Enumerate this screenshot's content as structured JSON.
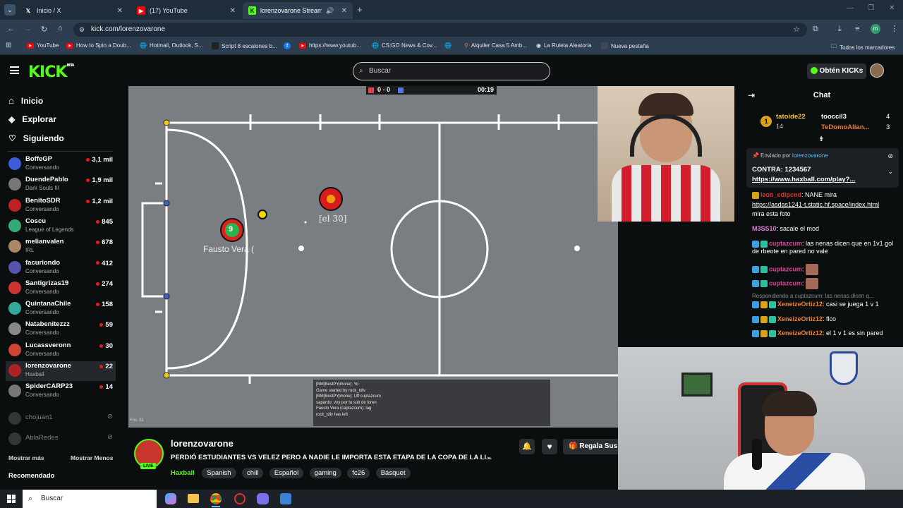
{
  "browser": {
    "tabs": [
      {
        "label": "Inicio / X"
      },
      {
        "label": "(17) YouTube"
      },
      {
        "label": "lorenzovarone Stream - Wa"
      }
    ],
    "url": "kick.com/lorenzovarone",
    "bookmarks": [
      "YouTube",
      "How to Spin a Doub...",
      "Hotmail, Outlook, S...",
      "Script 8 escalones b...",
      "https://www.youtub...",
      "CS:GO News & Cov...",
      "Alquiler Casa 5 Amb...",
      "La Ruleta Aleatoria",
      "Nueva pestaña",
      "Todos los marcadores"
    ]
  },
  "header": {
    "logo": "KICK",
    "logo_badge": "BETA",
    "search_placeholder": "Buscar",
    "get_kicks": "Obtén KICKs"
  },
  "sidebar": {
    "nav": [
      "Inicio",
      "Explorar",
      "Siguiendo"
    ],
    "channels": [
      {
        "name": "BoffeGP",
        "sub": "Conversando",
        "viewers": "3,1 mil"
      },
      {
        "name": "DuendePablo",
        "sub": "Dark Souls III",
        "viewers": "1,9 mil"
      },
      {
        "name": "BenitoSDR",
        "sub": "Conversando",
        "viewers": "1,2 mil"
      },
      {
        "name": "Coscu",
        "sub": "League of Legends",
        "viewers": "845"
      },
      {
        "name": "melianvalen",
        "sub": "IRL",
        "viewers": "678"
      },
      {
        "name": "facuriondo",
        "sub": "Conversando",
        "viewers": "412"
      },
      {
        "name": "Santigrizas19",
        "sub": "Conversando",
        "viewers": "274"
      },
      {
        "name": "QuintanaChile",
        "sub": "Conversando",
        "viewers": "158"
      },
      {
        "name": "Natabenitezzz",
        "sub": "Conversando",
        "viewers": "59"
      },
      {
        "name": "Lucassveronn",
        "sub": "Conversando",
        "viewers": "30"
      },
      {
        "name": "lorenzovarone",
        "sub": "Haxball",
        "viewers": "22"
      },
      {
        "name": "SpiderCARP23",
        "sub": "Conversando",
        "viewers": "14"
      }
    ],
    "offline": [
      "chojuan1",
      "AblaRedes"
    ],
    "show_more": "Mostrar más",
    "show_less": "Mostrar Menos",
    "recommended": "Recomendado"
  },
  "game": {
    "score": "0 - 0",
    "time": "00:19",
    "player1": "Fausto Vera (",
    "player1_number": "9",
    "player2": "[el 30]",
    "fps": "Fps: 61",
    "log": [
      "[BM]BestPYphone]: Yo",
      "Game started by rock_tdlv",
      "[BM]BestPYphone]: Uff cuptazcum",
      "sapardo: voy por la sub de loren",
      "Fausto Vera (captazcum): lag",
      "rock_tdlv has left"
    ]
  },
  "stream": {
    "channel": "lorenzovarone",
    "live": "LIVE",
    "title": "PERDIÓ ESTUDIANTES VS VELEZ PERO A NADIE LE IMPORTA ESTA ETAPA DE LA COPA DE LA LI...",
    "category": "Haxball",
    "tags": [
      "Spanish",
      "chill",
      "Español",
      "gaming",
      "fc26",
      "Básquet"
    ],
    "gift": "Regala Sus"
  },
  "chat": {
    "title": "Chat",
    "leaders": [
      {
        "rank": "1",
        "name": "tatoide22",
        "count": "14"
      },
      {
        "name": "tooccil3",
        "count": "4"
      },
      {
        "name": "TeDomoAlian...",
        "count": "3"
      }
    ],
    "pinned": {
      "sent_by": "Enviado por",
      "user": "lorenzovarone",
      "text": "CONTRA: 1234567",
      "link": "https://www.haxball.com/play?..."
    },
    "messages": [
      {
        "user": "leon_edipcnd",
        "text": ": NANE mira"
      },
      {
        "user": "",
        "text": "https://asdas1241-t.static.hf.space/index.html"
      },
      {
        "user": "",
        "text": "mira esta foto"
      },
      {
        "user": "M3SS10",
        "text": ": sacale el mod"
      },
      {
        "user": "cuptazcum",
        "text": ": las nenas dicen que en 1v1 gol de rbeote en pared no vale"
      },
      {
        "user": "cuptazcum",
        "text": ":"
      },
      {
        "user": "cuptazcum",
        "text": ":"
      },
      {
        "user": "",
        "text": "Respondiendo a cuptazcum: las nenas dicen q..."
      },
      {
        "user": "XeneizeOrtiz12",
        "text": ": casi se juega 1 v 1"
      },
      {
        "user": "XeneizeOrtiz12",
        "text": ": flco"
      },
      {
        "user": "XeneizeOrtiz12",
        "text": ": el 1 v 1 es sin pared"
      }
    ]
  },
  "taskbar": {
    "search": "Buscar"
  },
  "colors": {
    "kick_green": "#53fc18",
    "live_red": "#e91916"
  }
}
